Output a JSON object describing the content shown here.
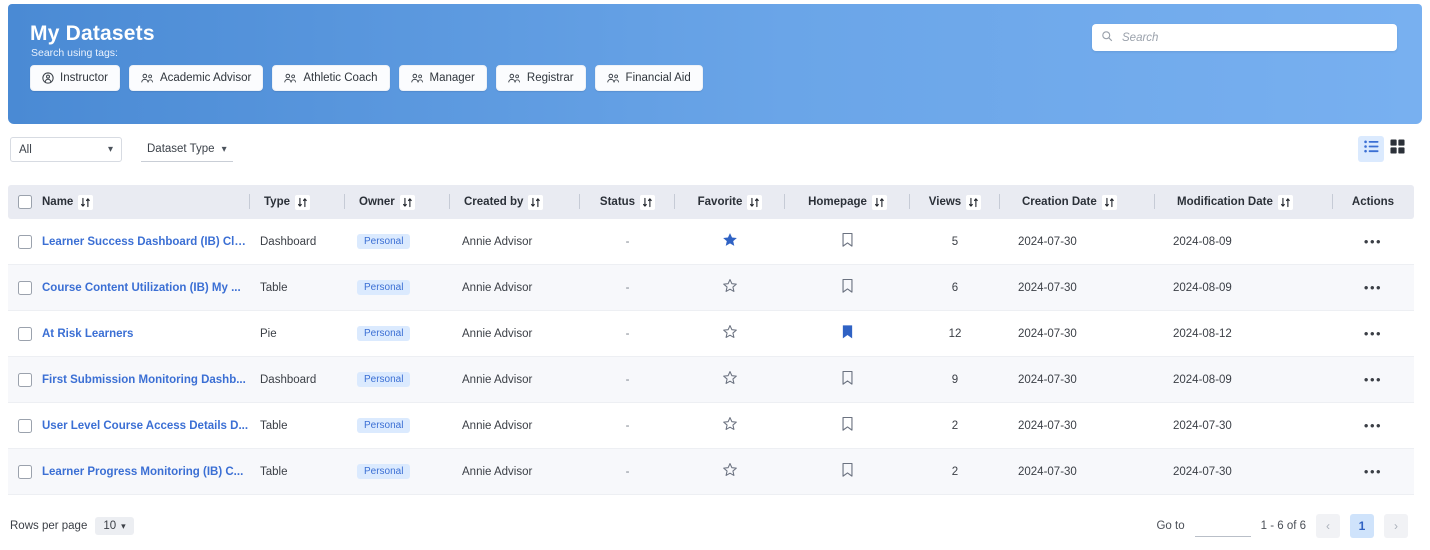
{
  "header": {
    "title": "My Datasets",
    "subtitle": "Search using tags:",
    "tags": [
      {
        "label": "Instructor",
        "icon": "badge-person-icon"
      },
      {
        "label": "Academic Advisor",
        "icon": "people-group-icon"
      },
      {
        "label": "Athletic Coach",
        "icon": "people-group-icon"
      },
      {
        "label": "Manager",
        "icon": "people-group-icon"
      },
      {
        "label": "Registrar",
        "icon": "people-group-icon"
      },
      {
        "label": "Financial Aid",
        "icon": "people-group-icon"
      }
    ],
    "search": {
      "placeholder": "Search",
      "value": "",
      "icon": "search-icon"
    }
  },
  "toolbar": {
    "scope_filter": "All",
    "type_filter": "Dataset Type",
    "view_list_icon": "list-view-icon",
    "view_grid_icon": "grid-view-icon",
    "active_view": "list"
  },
  "table": {
    "columns": [
      "Name",
      "Type",
      "Owner",
      "Created by",
      "Status",
      "Favorite",
      "Homepage",
      "Views",
      "Creation Date",
      "Modification Date",
      "Actions"
    ],
    "rows": [
      {
        "name": "Learner Success Dashboard (IB) Clo...",
        "type": "Dashboard",
        "owner": "Personal",
        "created_by": "Annie Advisor",
        "status": "-",
        "favorite": true,
        "homepage": false,
        "views": "5",
        "creation_date": "2024-07-30",
        "modification_date": "2024-08-09",
        "actions": "•••"
      },
      {
        "name": "Course Content Utilization (IB) My ...",
        "type": "Table",
        "owner": "Personal",
        "created_by": "Annie Advisor",
        "status": "-",
        "favorite": false,
        "homepage": false,
        "views": "6",
        "creation_date": "2024-07-30",
        "modification_date": "2024-08-09",
        "actions": "•••"
      },
      {
        "name": "At Risk Learners",
        "type": "Pie",
        "owner": "Personal",
        "created_by": "Annie Advisor",
        "status": "-",
        "favorite": false,
        "homepage": true,
        "views": "12",
        "creation_date": "2024-07-30",
        "modification_date": "2024-08-12",
        "actions": "•••"
      },
      {
        "name": "First Submission Monitoring Dashb...",
        "type": "Dashboard",
        "owner": "Personal",
        "created_by": "Annie Advisor",
        "status": "-",
        "favorite": false,
        "homepage": false,
        "views": "9",
        "creation_date": "2024-07-30",
        "modification_date": "2024-08-09",
        "actions": "•••"
      },
      {
        "name": "User Level Course Access Details D...",
        "type": "Table",
        "owner": "Personal",
        "created_by": "Annie Advisor",
        "status": "-",
        "favorite": false,
        "homepage": false,
        "views": "2",
        "creation_date": "2024-07-30",
        "modification_date": "2024-07-30",
        "actions": "•••"
      },
      {
        "name": "Learner Progress Monitoring (IB) C...",
        "type": "Table",
        "owner": "Personal",
        "created_by": "Annie Advisor",
        "status": "-",
        "favorite": false,
        "homepage": false,
        "views": "2",
        "creation_date": "2024-07-30",
        "modification_date": "2024-07-30",
        "actions": "•••"
      }
    ]
  },
  "footer": {
    "rows_per_page_label": "Rows per page",
    "rows_per_page_value": "10",
    "goto_label": "Go to",
    "goto_value": "",
    "range_text": "1 - 6 of 6",
    "prev_icon": "chevron-left-icon",
    "next_icon": "chevron-right-icon",
    "current_page": "1"
  },
  "colors": {
    "accent": "#3b6fd4",
    "header_gradient_start": "#4a8ad4",
    "header_gradient_end": "#78b0f0",
    "badge_bg": "#dbeafe",
    "table_header_bg": "#e9ebf2"
  }
}
